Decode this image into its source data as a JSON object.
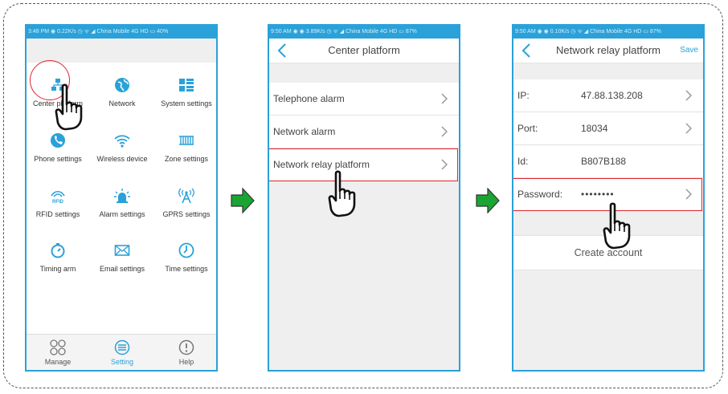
{
  "colors": {
    "accent": "#2aa1d8",
    "highlight": "#e0242c",
    "arrow": "#1aa533"
  },
  "screen1": {
    "status": "3:48 PM  ◉  0.22K/s  ◷ ᯤ ◢ China Mobile 4G HD ▭ 40%",
    "grid": [
      {
        "label": "Center platform",
        "icon": "center-platform-icon"
      },
      {
        "label": "Network",
        "icon": "globe-icon"
      },
      {
        "label": "System settings",
        "icon": "system-settings-icon"
      },
      {
        "label": "Phone settings",
        "icon": "phone-icon"
      },
      {
        "label": "Wireless device",
        "icon": "wifi-icon"
      },
      {
        "label": "Zone settings",
        "icon": "zone-icon"
      },
      {
        "label": "RFID settings",
        "icon": "rfid-icon"
      },
      {
        "label": "Alarm settings",
        "icon": "siren-icon"
      },
      {
        "label": "GPRS settings",
        "icon": "antenna-icon"
      },
      {
        "label": "Timing arm",
        "icon": "timer-icon"
      },
      {
        "label": "Email settings",
        "icon": "envelope-icon"
      },
      {
        "label": "Time settings",
        "icon": "clock-icon"
      }
    ],
    "tabs": [
      {
        "label": "Manage",
        "icon": "grid-circles-icon"
      },
      {
        "label": "Setting",
        "icon": "list-circle-icon"
      },
      {
        "label": "Help",
        "icon": "info-circle-icon"
      }
    ]
  },
  "screen2": {
    "status": "9:50 AM  ◉ ◉  3.89K/s  ◷ ᯤ ◢ China Mobile 4G HD ▭ 87%",
    "title": "Center platform",
    "items": [
      {
        "label": "Telephone alarm"
      },
      {
        "label": "Network alarm"
      },
      {
        "label": "Network relay platform"
      }
    ]
  },
  "screen3": {
    "status": "9:50 AM  ◉ ◉  0.10K/s  ◷ ᯤ ◢ China Mobile 4G HD ▭ 87%",
    "title": "Network relay platform",
    "save": "Save",
    "fields": [
      {
        "label": "IP:",
        "value": "47.88.138.208"
      },
      {
        "label": "Port:",
        "value": "18034"
      },
      {
        "label": "Id:",
        "value": "B807B188"
      },
      {
        "label": "Password:",
        "value": "••••••••"
      }
    ],
    "create": "Create account"
  }
}
